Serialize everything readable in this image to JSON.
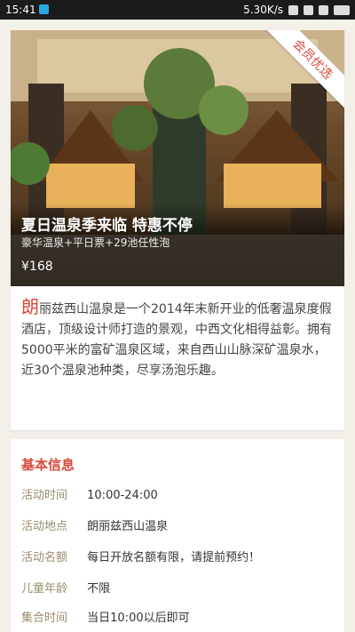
{
  "status_bar": {
    "time": "15:41",
    "net_speed": "5.30K/s"
  },
  "hero": {
    "badge": "会员优选",
    "title": "夏日温泉季来临 特惠不停",
    "subtitle": "豪华温泉+平日票+29池任性泡",
    "price": "¥168"
  },
  "description": {
    "first_char": "朗",
    "text": "丽兹西山温泉是一个2014年末新开业的低奢温泉度假酒店，顶级设计师打造的景观，中西文化相得益彰。拥有5000平米的富矿温泉区域，来自西山山脉深矿温泉水，近30个温泉池种类，尽享汤泡乐趣。"
  },
  "basic_info": {
    "title": "基本信息",
    "rows": [
      {
        "label": "活动时间",
        "value": "10:00-24:00"
      },
      {
        "label": "活动地点",
        "value": "朗丽兹西山温泉"
      },
      {
        "label": "活动名额",
        "value": "每日开放名额有限，请提前预约！"
      },
      {
        "label": "儿童年龄",
        "value": "不限"
      },
      {
        "label": "集合时间",
        "value": "当日10:00以后即可"
      }
    ]
  }
}
